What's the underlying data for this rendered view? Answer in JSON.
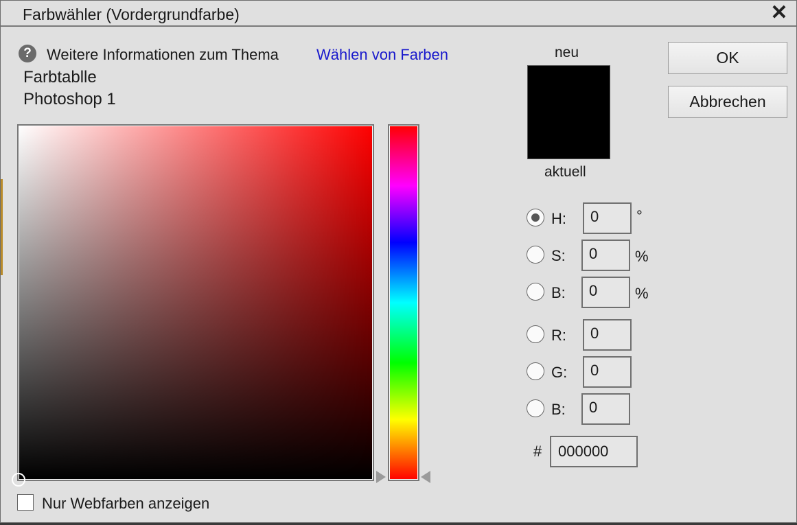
{
  "window": {
    "title": "Farbwähler (Vordergrundfarbe)",
    "close_glyph": "✕"
  },
  "info": {
    "help_glyph": "?",
    "text": "Weitere Informationen zum Thema",
    "link": "Wählen von Farben"
  },
  "library": {
    "name": "Farbtablle",
    "entry": "Photoshop 1"
  },
  "preview": {
    "new_label": "neu",
    "current_label": "aktuell",
    "color": "#000000"
  },
  "buttons": {
    "ok": "OK",
    "cancel": "Abbrechen"
  },
  "fields": {
    "h": {
      "label": "H:",
      "value": "0",
      "unit": "°",
      "selected": true
    },
    "s": {
      "label": "S:",
      "value": "0",
      "unit": "%",
      "selected": false
    },
    "b_hsb": {
      "label": "B:",
      "value": "0",
      "unit": "%",
      "selected": false
    },
    "r": {
      "label": "R:",
      "value": "0",
      "selected": false
    },
    "g": {
      "label": "G:",
      "value": "0",
      "selected": false
    },
    "b_rgb": {
      "label": "B:",
      "value": "0",
      "selected": false
    },
    "hex": {
      "prefix": "#",
      "value": "000000"
    }
  },
  "web_only": {
    "label": "Nur Webfarben anzeigen",
    "checked": false
  },
  "colors": {
    "hue_base": "#ff0000",
    "link": "#1a1acc",
    "dialog_bg": "#e0e0e0"
  }
}
